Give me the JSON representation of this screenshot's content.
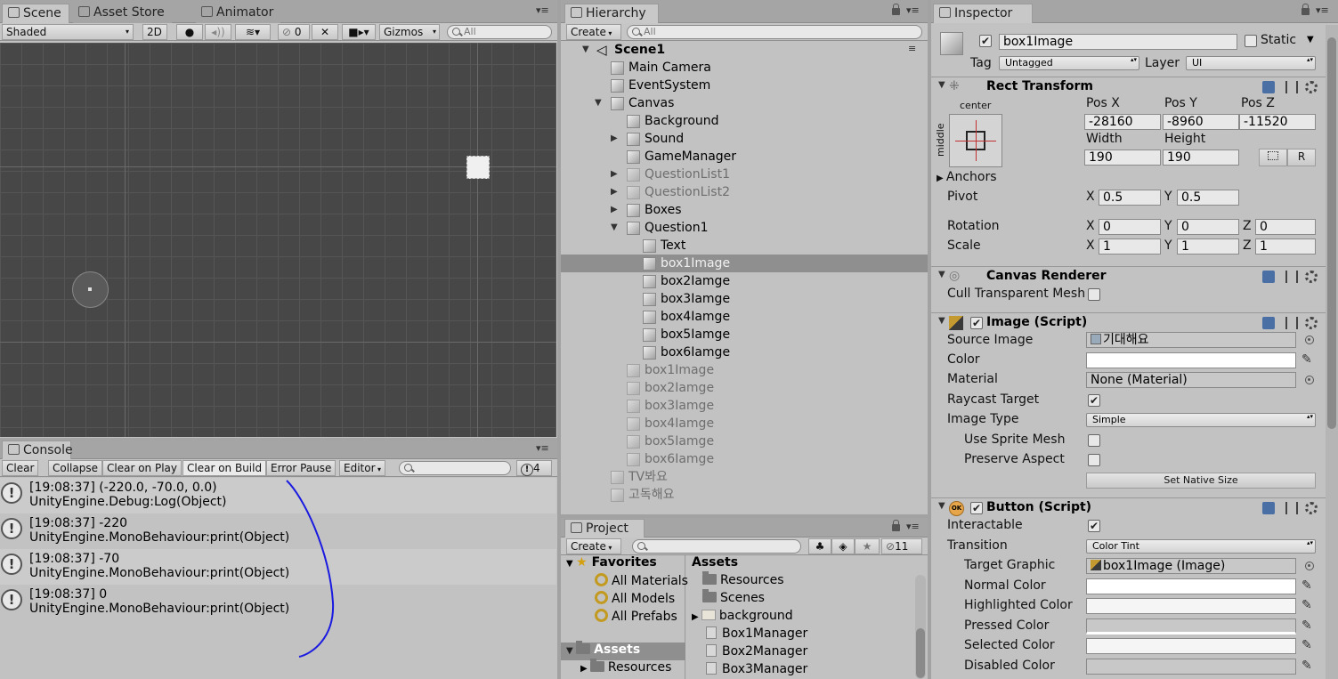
{
  "scene": {
    "tabs": [
      "Scene",
      "Asset Store",
      "Animator"
    ],
    "shading": "Shaded",
    "btn_2d": "2D",
    "fx_count": "0",
    "gizmos": "Gizmos",
    "search_placeholder": "All"
  },
  "console": {
    "tab": "Console",
    "buttons": [
      "Clear",
      "Collapse",
      "Clear on Play",
      "Clear on Build",
      "Error Pause",
      "Editor"
    ],
    "count": "4",
    "entries": [
      {
        "line1": "[19:08:37] (-220.0, -70.0, 0.0)",
        "line2": "UnityEngine.Debug:Log(Object)"
      },
      {
        "line1": "[19:08:37] -220",
        "line2": "UnityEngine.MonoBehaviour:print(Object)"
      },
      {
        "line1": "[19:08:37] -70",
        "line2": "UnityEngine.MonoBehaviour:print(Object)"
      },
      {
        "line1": "[19:08:37] 0",
        "line2": "UnityEngine.MonoBehaviour:print(Object)"
      }
    ]
  },
  "hierarchy": {
    "tab": "Hierarchy",
    "create": "Create",
    "search_placeholder": "All",
    "scene_name": "Scene1",
    "items": [
      {
        "label": "Main Camera"
      },
      {
        "label": "EventSystem"
      },
      {
        "label": "Canvas"
      },
      {
        "label": "Background"
      },
      {
        "label": "Sound"
      },
      {
        "label": "GameManager"
      },
      {
        "label": "QuestionList1"
      },
      {
        "label": "QuestionList2"
      },
      {
        "label": "Boxes"
      },
      {
        "label": "Question1"
      },
      {
        "label": "Text"
      },
      {
        "label": "box1Image"
      },
      {
        "label": "box2Iamge"
      },
      {
        "label": "box3Iamge"
      },
      {
        "label": "box4Iamge"
      },
      {
        "label": "box5Iamge"
      },
      {
        "label": "box6Iamge"
      },
      {
        "label": "box1Image"
      },
      {
        "label": "box2Iamge"
      },
      {
        "label": "box3Iamge"
      },
      {
        "label": "box4Iamge"
      },
      {
        "label": "box5Iamge"
      },
      {
        "label": "box6Iamge"
      },
      {
        "label": "TV봐요"
      },
      {
        "label": "고독해요"
      }
    ]
  },
  "project": {
    "tab": "Project",
    "create": "Create",
    "count": "11",
    "favorites": "Favorites",
    "fav_items": [
      "All Materials",
      "All Models",
      "All Prefabs"
    ],
    "assets_root": "Assets",
    "assets_child": "Resources",
    "assets_header": "Assets",
    "asset_items": [
      "Resources",
      "Scenes",
      "background",
      "Box1Manager",
      "Box2Manager",
      "Box3Manager"
    ]
  },
  "inspector": {
    "tab": "Inspector",
    "object_name": "box1Image",
    "static": "Static",
    "tag_label": "Tag",
    "tag_value": "Untagged",
    "layer_label": "Layer",
    "layer_value": "UI",
    "rect_transform": {
      "title": "Rect Transform",
      "anchor_h": "center",
      "anchor_v": "middle",
      "posx_label": "Pos X",
      "posy_label": "Pos Y",
      "posz_label": "Pos Z",
      "posx": "-28160",
      "posy": "-8960",
      "posz": "-11520",
      "width_label": "Width",
      "height_label": "Height",
      "width": "190",
      "height": "190",
      "r_button": "R",
      "anchors": "Anchors",
      "pivot": "Pivot",
      "pivot_x": "0.5",
      "pivot_y": "0.5",
      "rotation": "Rotation",
      "rot_x": "0",
      "rot_y": "0",
      "rot_z": "0",
      "scale": "Scale",
      "scale_x": "1",
      "scale_y": "1",
      "scale_z": "1",
      "x": "X",
      "y": "Y",
      "z": "Z"
    },
    "canvas_renderer": {
      "title": "Canvas Renderer",
      "cull": "Cull Transparent Mesh"
    },
    "image": {
      "title": "Image (Script)",
      "source_label": "Source Image",
      "source_value": "기대해요",
      "color_label": "Color",
      "material_label": "Material",
      "material_value": "None (Material)",
      "raycast_label": "Raycast Target",
      "type_label": "Image Type",
      "type_value": "Simple",
      "sprite_mesh": "Use Sprite Mesh",
      "preserve": "Preserve Aspect",
      "native_size": "Set Native Size"
    },
    "button": {
      "title": "Button (Script)",
      "interactable": "Interactable",
      "transition": "Transition",
      "transition_value": "Color Tint",
      "target_graphic": "Target Graphic",
      "target_value": "box1Image (Image)",
      "normal": "Normal Color",
      "highlighted": "Highlighted Color",
      "pressed": "Pressed Color",
      "selected": "Selected Color",
      "disabled": "Disabled Color"
    }
  }
}
